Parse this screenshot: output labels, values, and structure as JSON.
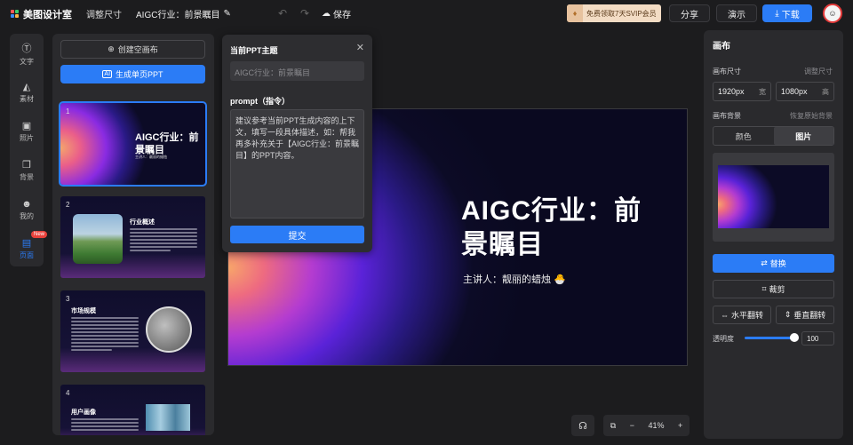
{
  "topbar": {
    "app_name": "美图设计室",
    "resize_label": "调整尺寸",
    "doc_title": "AIGC行业：前景瞩目",
    "save_label": "保存",
    "vip_label": "免费领取7天SVIP会员",
    "share_label": "分享",
    "present_label": "演示",
    "download_label": "下载"
  },
  "rail": {
    "items": [
      {
        "label": "文字",
        "icon": "text-icon"
      },
      {
        "label": "素材",
        "icon": "shapes-icon"
      },
      {
        "label": "照片",
        "icon": "image-icon"
      },
      {
        "label": "背景",
        "icon": "background-icon"
      },
      {
        "label": "我的",
        "icon": "user-icon"
      },
      {
        "label": "页面",
        "icon": "pages-icon",
        "badge": "New"
      }
    ]
  },
  "pages_panel": {
    "create_blank_label": "创建空画布",
    "generate_label": "生成单页PPT",
    "slides": [
      {
        "num": "1",
        "title": "AIGC行业：前景瞩目",
        "subtitle": "主讲人：靓丽的蜡烛"
      },
      {
        "num": "2",
        "title": "行业概述"
      },
      {
        "num": "3",
        "title": "市场规模"
      },
      {
        "num": "4",
        "title": "用户画像"
      }
    ]
  },
  "popup": {
    "theme_heading": "当前PPT主题",
    "theme_placeholder": "AIGC行业：前景瞩目",
    "prompt_heading": "prompt（指令）",
    "prompt_text": "建议参考当前PPT生成内容的上下文，填写一段具体描述，如：帮我再多补充关于【AIGC行业：前景瞩目】的PPT内容。",
    "submit_label": "提交"
  },
  "canvas": {
    "title": "AIGC行业：前景瞩目",
    "subtitle": "主讲人：靓丽的蜡烛 🐣"
  },
  "zoom": {
    "minus": "−",
    "value": "41%",
    "plus": "+"
  },
  "right_panel": {
    "heading": "画布",
    "size_label": "画布尺寸",
    "resize_link": "调整尺寸",
    "width_value": "1920px",
    "width_unit": "宽",
    "height_value": "1080px",
    "height_unit": "高",
    "bg_label": "画布背景",
    "restore_link": "恢复原始背景",
    "tab_color": "颜色",
    "tab_image": "图片",
    "replace_label": "替换",
    "crop_label": "裁剪",
    "flip_h_label": "水平翻转",
    "flip_v_label": "垂直翻转",
    "opacity_label": "透明度",
    "opacity_value": "100"
  },
  "colors": {
    "accent": "#2b7cf6",
    "background": "#1c1c1e",
    "panel": "#2a2a2d"
  }
}
